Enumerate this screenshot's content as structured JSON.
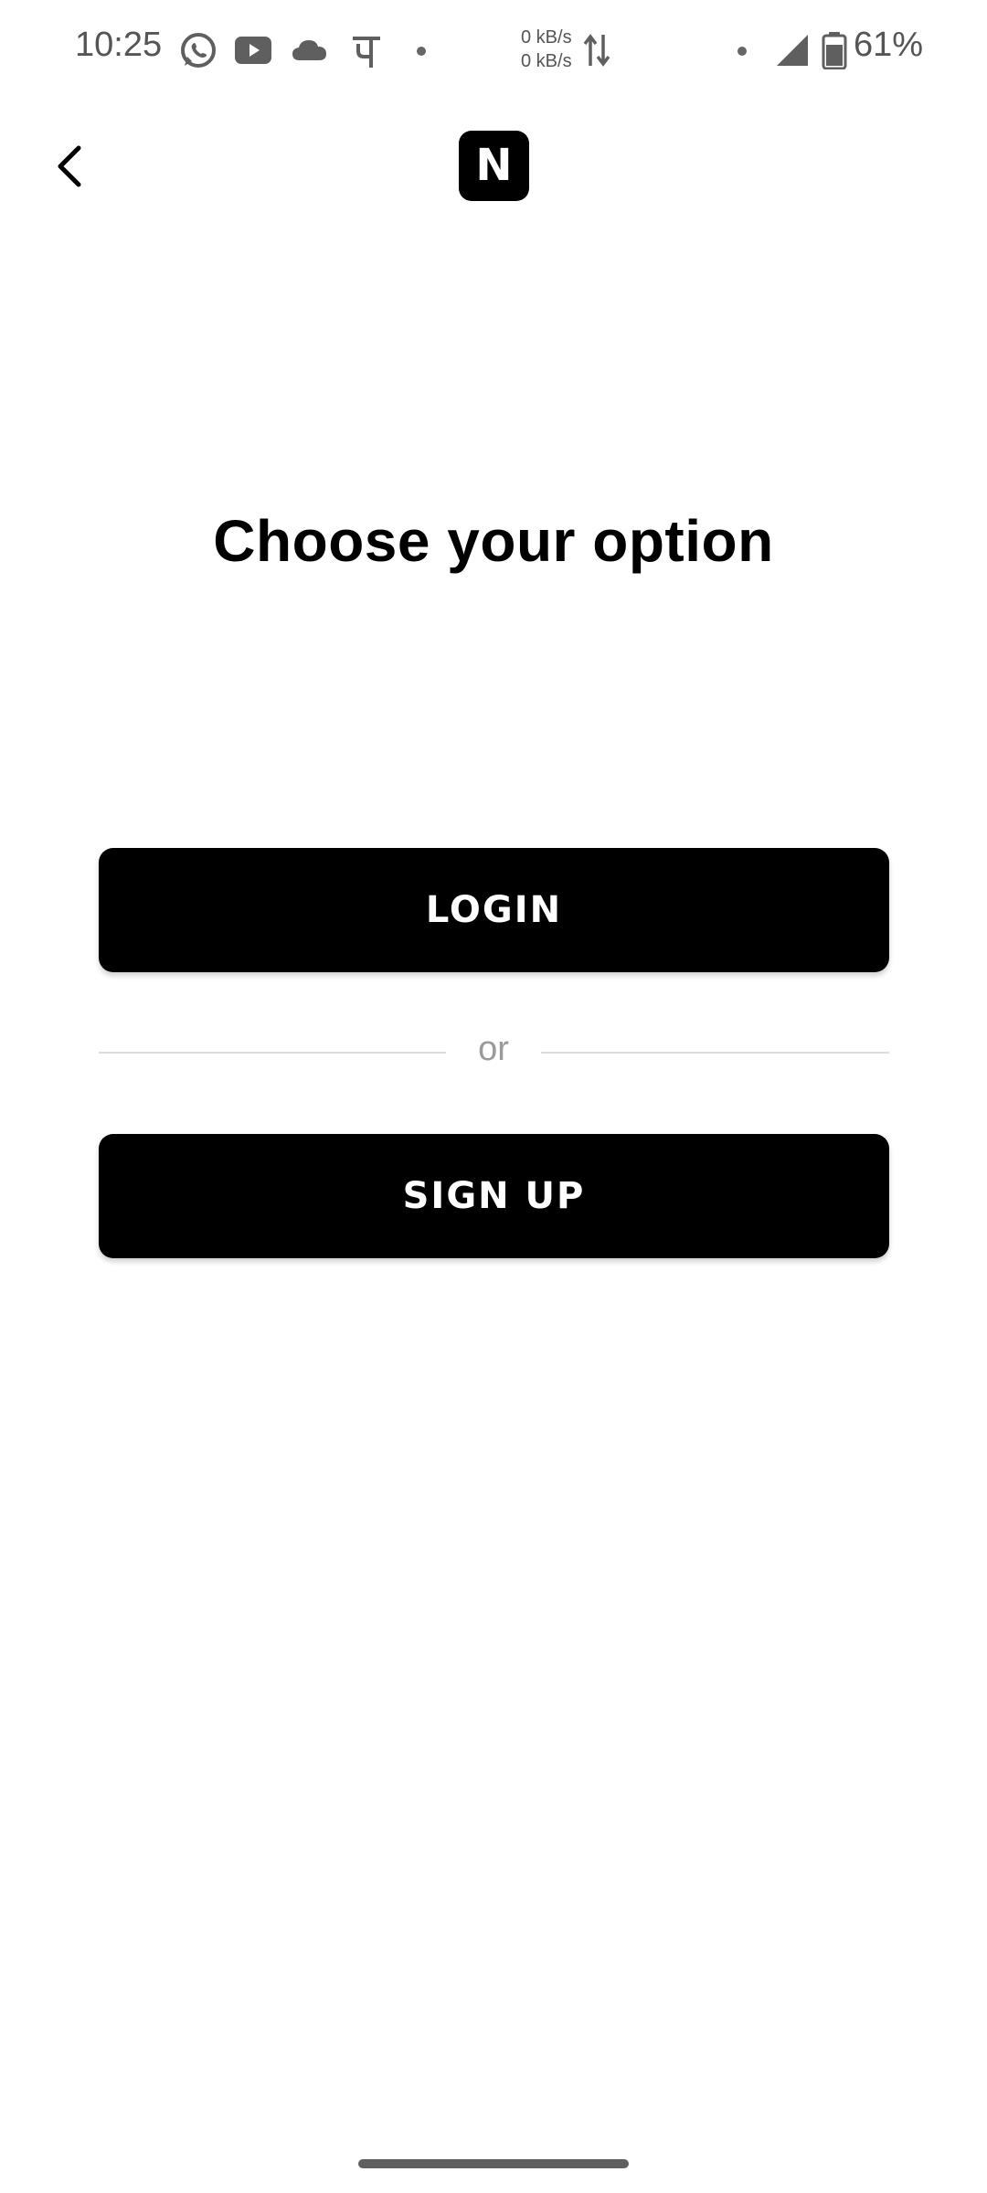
{
  "status_bar": {
    "time": "10:25",
    "net_up": "0 kB/s",
    "net_down": "0 kB/s",
    "battery": "61%",
    "icons": [
      "whatsapp-icon",
      "youtube-icon",
      "cloud-icon",
      "phonepe-icon",
      "notification-dot",
      "data-transfer-icon",
      "signal-icon",
      "battery-icon"
    ]
  },
  "header": {
    "back_icon": "chevron-left-icon",
    "logo_letter": "N"
  },
  "main": {
    "title": "Choose your option",
    "login_label": "LOGIN",
    "divider_text": "or",
    "signup_label": "SIGN UP"
  },
  "colors": {
    "button_bg": "#000000",
    "button_text": "#ffffff",
    "divider": "#dcdcdc",
    "muted_text": "#9a9a9a"
  }
}
